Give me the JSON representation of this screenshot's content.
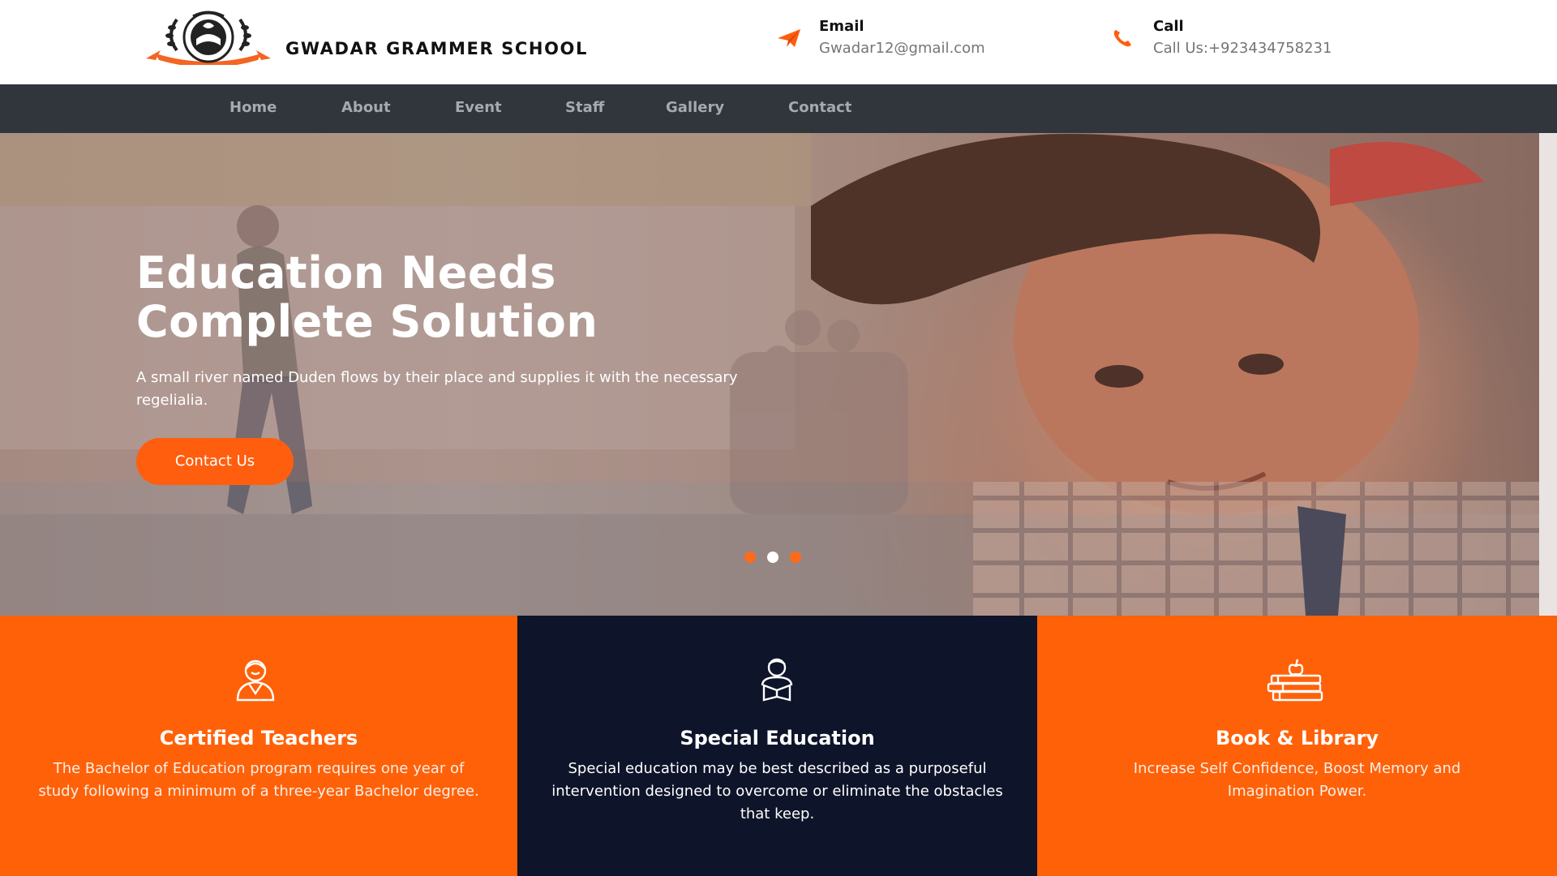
{
  "header": {
    "school_name": "GWADAR GRAMMER SCHOOL",
    "logo_icon": "school-crest-logo",
    "email_title": "Email",
    "email_value": "Gwadar12@gmail.com",
    "call_title": "Call",
    "call_value": "Call Us:+923434758231"
  },
  "nav": {
    "items": [
      {
        "label": "Home",
        "active": true
      },
      {
        "label": "About",
        "active": false
      },
      {
        "label": "Event",
        "active": false
      },
      {
        "label": "Staff",
        "active": false
      },
      {
        "label": "Gallery",
        "active": false
      },
      {
        "label": "Contact",
        "active": false
      }
    ]
  },
  "hero": {
    "title_line1": "Education Needs",
    "title_line2": "Complete Solution",
    "description": "A small river named Duden flows by their place and supplies it with the necessary regelialia.",
    "button_label": "Contact Us",
    "slide_count": 3,
    "active_slide": 2
  },
  "features": [
    {
      "icon": "teacher-icon",
      "title": "Certified Teachers",
      "text": "The Bachelor of Education program requires one year of study following a minimum of a three-year Bachelor degree."
    },
    {
      "icon": "reading-student-icon",
      "title": "Special Education",
      "text": "Special education may be best described as a purposeful intervention designed to overcome or eliminate the obstacles that keep."
    },
    {
      "icon": "books-apple-icon",
      "title": "Book & Library",
      "text": "Increase Self Confidence, Boost Memory and Imagination Power."
    }
  ],
  "colors": {
    "accent_orange": "#ff6108",
    "nav_background": "#31363c",
    "feature_navy": "#0e1429"
  }
}
